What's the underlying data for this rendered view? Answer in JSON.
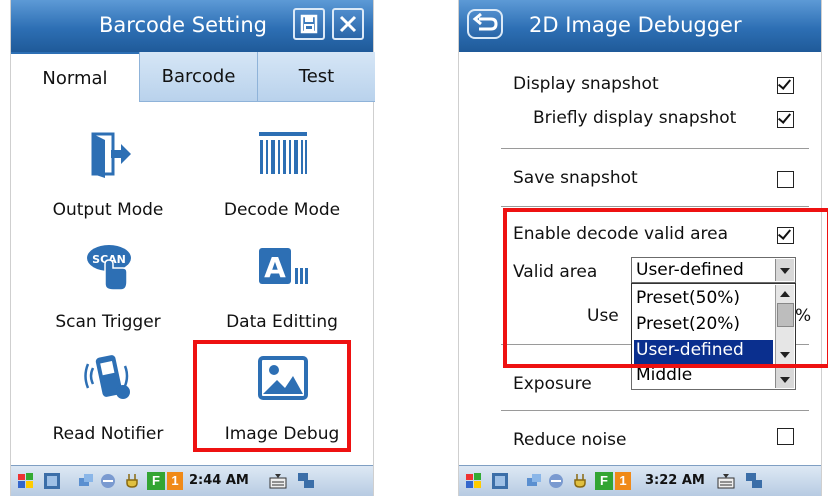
{
  "left_screen": {
    "title": "Barcode Setting",
    "tabs": [
      "Normal",
      "Barcode",
      "Test"
    ],
    "items": [
      {
        "label": "Output Mode",
        "icon": "output-mode-icon"
      },
      {
        "label": "Decode Mode",
        "icon": "barcode-icon"
      },
      {
        "label": "Scan Trigger",
        "icon": "scan-trigger-icon"
      },
      {
        "label": "Data Editting",
        "icon": "data-editing-icon"
      },
      {
        "label": "Read Notifier",
        "icon": "phone-vibrate-icon"
      },
      {
        "label": "Image Debug",
        "icon": "image-icon"
      }
    ],
    "taskbar": {
      "clock": "2:44 AM",
      "badge": "1"
    }
  },
  "right_screen": {
    "title": "2D Image Debugger",
    "display_snapshot": {
      "label": "Display snapshot",
      "checked": true
    },
    "briefly_display_snapshot": {
      "label": "Briefly display snapshot",
      "checked": true
    },
    "save_snapshot": {
      "label": "Save snapshot",
      "checked": false
    },
    "enable_valid_area": {
      "label": "Enable decode valid area",
      "checked": true
    },
    "valid_area": {
      "label": "Valid area",
      "value": "User-defined"
    },
    "dropdown_options": [
      "Preset(50%)",
      "Preset(20%)",
      "User-defined"
    ],
    "selected_option": "User-defined",
    "hidden_row_label_partial": "Use",
    "hidden_row_suffix": "%",
    "exposure": {
      "label": "Exposure",
      "value": "Middle"
    },
    "reduce_noise": {
      "label": "Reduce noise",
      "checked": false
    },
    "taskbar": {
      "clock": "3:22 AM",
      "badge": "1"
    }
  },
  "colors": {
    "titlebar": "#2d6fb4",
    "highlight": "#ee1111",
    "selection": "#0a2f8e"
  }
}
